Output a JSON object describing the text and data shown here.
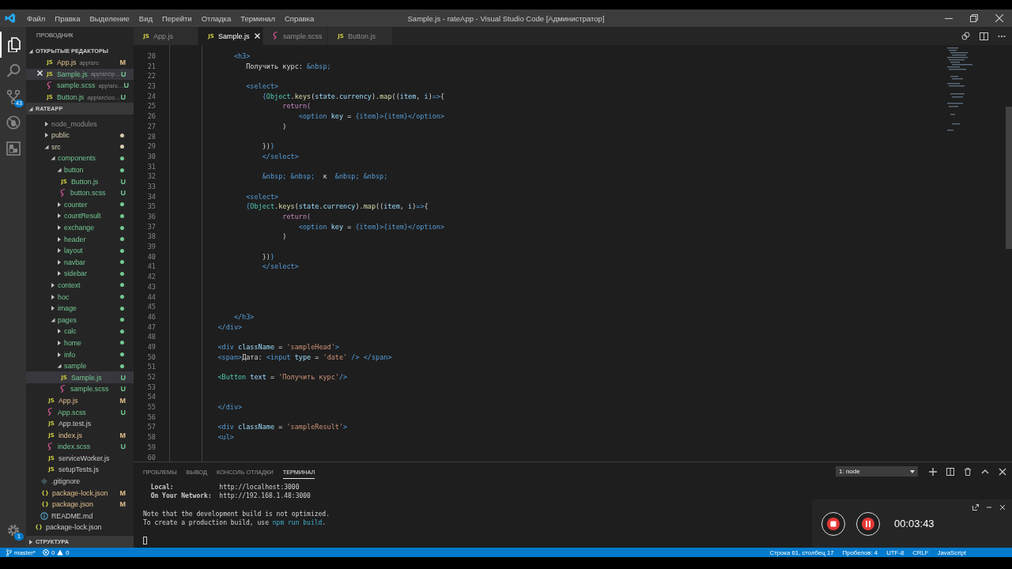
{
  "window": {
    "title": "Sample.js - rateApp - Visual Studio Code [Администратор]"
  },
  "menu": [
    "Файл",
    "Правка",
    "Выделение",
    "Вид",
    "Перейти",
    "Отладка",
    "Терминал",
    "Справка"
  ],
  "activity_bar": [
    {
      "kind": "explorer",
      "selected": true
    },
    {
      "kind": "search",
      "selected": false
    },
    {
      "kind": "source-control",
      "selected": false,
      "badge": "43"
    },
    {
      "kind": "debug",
      "selected": false
    },
    {
      "kind": "extensions",
      "selected": false
    }
  ],
  "manage": {
    "badge": "1"
  },
  "sidebar": {
    "title": "ПРОВОДНИК",
    "open_editors": {
      "title": "ОТКРЫТЫЕ РЕДАКТОРЫ",
      "expanded": true,
      "items": [
        {
          "name": "App.js",
          "path": "app\\src",
          "kind": "js",
          "icon_text": "JS",
          "color": "#e2c08d",
          "badge": "M",
          "selected": false
        },
        {
          "name": "Sample.js",
          "path": "app\\src\\p…",
          "kind": "js",
          "icon_text": "JS",
          "color": "#73c991",
          "badge": "U",
          "selected": true
        },
        {
          "name": "sample.scss",
          "path": "app\\src…",
          "kind": "scss",
          "color": "#73c991",
          "badge": "U",
          "selected": false
        },
        {
          "name": "Button.js",
          "path": "app\\src\\co…",
          "kind": "js",
          "icon_text": "JS",
          "color": "#73c991",
          "badge": "U",
          "selected": false
        }
      ]
    },
    "project": {
      "title": "RATEAPP",
      "expanded": true,
      "items": [
        {
          "name": "node_modules",
          "kind": "folder",
          "expanded": false,
          "ignored": true,
          "selected": false
        },
        {
          "name": "public",
          "kind": "folder",
          "expanded": false,
          "color": "#d9cdb0",
          "selected": false
        },
        {
          "name": "src",
          "kind": "folder",
          "expanded": true,
          "color": "#d9cdb0",
          "selected": false,
          "children": [
            {
              "name": "components",
              "kind": "folder",
              "expanded": true,
              "color": "#73c991",
              "selected": false,
              "children": [
                {
                  "name": "button",
                  "kind": "folder",
                  "expanded": true,
                  "color": "#73c991",
                  "selected": false,
                  "children": [
                    {
                      "name": "Button.js",
                      "kind": "js",
                      "icon_text": "JS",
                      "color": "#73c991",
                      "badge": "U",
                      "selected": false
                    },
                    {
                      "name": "button.scss",
                      "kind": "scss",
                      "color": "#73c991",
                      "badge": "U",
                      "selected": false
                    }
                  ]
                },
                {
                  "name": "counter",
                  "kind": "folder",
                  "expanded": false,
                  "color": "#73c991",
                  "selected": false
                },
                {
                  "name": "countResult",
                  "kind": "folder",
                  "expanded": false,
                  "color": "#73c991",
                  "selected": false
                },
                {
                  "name": "exchange",
                  "kind": "folder",
                  "expanded": false,
                  "color": "#73c991",
                  "selected": false
                },
                {
                  "name": "header",
                  "kind": "folder",
                  "expanded": false,
                  "color": "#73c991",
                  "selected": false
                },
                {
                  "name": "layout",
                  "kind": "folder",
                  "expanded": false,
                  "color": "#73c991",
                  "selected": false
                },
                {
                  "name": "navbar",
                  "kind": "folder",
                  "expanded": false,
                  "color": "#73c991",
                  "selected": false
                },
                {
                  "name": "sidebar",
                  "kind": "folder",
                  "expanded": false,
                  "color": "#73c991",
                  "selected": false
                }
              ]
            },
            {
              "name": "context",
              "kind": "folder",
              "expanded": false,
              "color": "#73c991",
              "selected": false
            },
            {
              "name": "hoc",
              "kind": "folder",
              "expanded": false,
              "color": "#73c991",
              "selected": false
            },
            {
              "name": "image",
              "kind": "folder",
              "expanded": false,
              "color": "#73c991",
              "selected": false
            },
            {
              "name": "pages",
              "kind": "folder",
              "expanded": true,
              "color": "#73c991",
              "selected": false,
              "children": [
                {
                  "name": "calc",
                  "kind": "folder",
                  "expanded": false,
                  "color": "#73c991",
                  "selected": false
                },
                {
                  "name": "home",
                  "kind": "folder",
                  "expanded": false,
                  "color": "#73c991",
                  "selected": false
                },
                {
                  "name": "info",
                  "kind": "folder",
                  "expanded": false,
                  "color": "#73c991",
                  "selected": false
                },
                {
                  "name": "sample",
                  "kind": "folder",
                  "expanded": true,
                  "color": "#73c991",
                  "selected": false,
                  "children": [
                    {
                      "name": "Sample.js",
                      "kind": "js",
                      "icon_text": "JS",
                      "color": "#73c991",
                      "badge": "U",
                      "selected": true
                    },
                    {
                      "name": "sample.scss",
                      "kind": "scss",
                      "color": "#73c991",
                      "badge": "U",
                      "selected": false
                    }
                  ]
                }
              ]
            },
            {
              "name": "App.js",
              "kind": "js",
              "icon_text": "JS",
              "color": "#e2c08d",
              "badge": "M",
              "selected": false
            },
            {
              "name": "App.scss",
              "kind": "scss",
              "color": "#73c991",
              "badge": "U",
              "selected": false
            },
            {
              "name": "App.test.js",
              "kind": "js",
              "icon_text": "JS",
              "selected": false
            },
            {
              "name": "index.js",
              "kind": "js",
              "icon_text": "JS",
              "color": "#e2c08d",
              "badge": "M",
              "selected": false
            },
            {
              "name": "index.scss",
              "kind": "scss",
              "color": "#73c991",
              "badge": "U",
              "selected": false
            },
            {
              "name": "serviceWorker.js",
              "kind": "js",
              "icon_text": "JS",
              "selected": false
            },
            {
              "name": "setupTests.js",
              "kind": "js",
              "icon_text": "JS",
              "selected": false
            }
          ]
        },
        {
          "name": ".gitignore",
          "kind": "gitignore",
          "selected": false
        },
        {
          "name": "package-lock.json",
          "kind": "json",
          "icon_text": "{}",
          "color": "#e2c08d",
          "badge": "M",
          "selected": false
        },
        {
          "name": "package.json",
          "kind": "json",
          "icon_text": "{}",
          "color": "#e2c08d",
          "badge": "M",
          "selected": false
        },
        {
          "name": "README.md",
          "kind": "info",
          "selected": false
        }
      ],
      "root_items": [
        {
          "name": "package-lock.json",
          "kind": "json",
          "icon_text": "{}",
          "selected": false
        }
      ]
    },
    "outline": {
      "title": "СТРУКТУРА",
      "expanded": false
    }
  },
  "tabs": [
    {
      "name": "App.js",
      "kind": "js",
      "icon_text": "JS",
      "selected": false
    },
    {
      "name": "Sample.js",
      "kind": "js",
      "icon_text": "JS",
      "selected": true
    },
    {
      "name": "sample.scss",
      "kind": "scss",
      "selected": false
    },
    {
      "name": "Button.js",
      "kind": "js",
      "icon_text": "JS",
      "selected": false
    }
  ],
  "editor": {
    "lines": [
      {
        "number": "20",
        "tokens": [
          {
            "kind": "tag",
            "text": "                <h3>"
          }
        ]
      },
      {
        "number": "21",
        "tokens": [
          {
            "kind": "txt",
            "text": "                   Получить курс: "
          },
          {
            "kind": "ent",
            "text": "&nbsp;"
          }
        ]
      },
      {
        "number": "22"
      },
      {
        "number": "23",
        "tokens": [
          {
            "kind": "tag",
            "text": "                   <select>"
          }
        ]
      },
      {
        "number": "24",
        "tokens": [
          {
            "kind": "op",
            "text": "                       {"
          },
          {
            "kind": "cls",
            "text": "Object"
          },
          {
            "kind": "txt",
            "text": "."
          },
          {
            "kind": "fn",
            "text": "keys"
          },
          {
            "kind": "txt",
            "text": "("
          },
          {
            "kind": "var",
            "text": "state"
          },
          {
            "kind": "txt",
            "text": "."
          },
          {
            "kind": "var",
            "text": "currency"
          },
          {
            "kind": "txt",
            "text": ")."
          },
          {
            "kind": "fn",
            "text": "map"
          },
          {
            "kind": "txt",
            "text": "(("
          },
          {
            "kind": "var",
            "text": "item"
          },
          {
            "kind": "txt",
            "text": ", "
          },
          {
            "kind": "var",
            "text": "i"
          },
          {
            "kind": "txt",
            "text": ")"
          },
          {
            "kind": "op",
            "text": "=>"
          },
          {
            "kind": "txt",
            "text": "{"
          }
        ]
      },
      {
        "number": "25",
        "tokens": [
          {
            "kind": "kw",
            "text": "                            return("
          }
        ]
      },
      {
        "number": "26",
        "tokens": [
          {
            "kind": "tag",
            "text": "                                <option"
          },
          {
            "kind": "var",
            "text": " key"
          },
          {
            "kind": "txt",
            "text": " = "
          },
          {
            "kind": "op",
            "text": "{item}"
          },
          {
            "kind": "tag",
            "text": ">"
          },
          {
            "kind": "op",
            "text": "{item}"
          },
          {
            "kind": "tag",
            "text": "</option>"
          }
        ]
      },
      {
        "number": "27",
        "tokens": [
          {
            "kind": "txt",
            "text": "                            )"
          }
        ]
      },
      {
        "number": "28"
      },
      {
        "number": "29",
        "tokens": [
          {
            "kind": "txt",
            "text": "                       })"
          },
          {
            "kind": "op",
            "text": "}"
          }
        ]
      },
      {
        "number": "30",
        "tokens": [
          {
            "kind": "tag",
            "text": "                       </select>"
          }
        ]
      },
      {
        "number": "31"
      },
      {
        "number": "32",
        "tokens": [
          {
            "kind": "ent",
            "text": "                       &nbsp; &nbsp;"
          },
          {
            "kind": "txt",
            "text": "  к  "
          },
          {
            "kind": "ent",
            "text": "&nbsp; &nbsp;"
          }
        ]
      },
      {
        "number": "33"
      },
      {
        "number": "34",
        "tokens": [
          {
            "kind": "tag",
            "text": "                   <select>"
          }
        ]
      },
      {
        "number": "35",
        "tokens": [
          {
            "kind": "op",
            "text": "                   {"
          },
          {
            "kind": "cls",
            "text": "Object"
          },
          {
            "kind": "txt",
            "text": "."
          },
          {
            "kind": "fn",
            "text": "keys"
          },
          {
            "kind": "txt",
            "text": "("
          },
          {
            "kind": "var",
            "text": "state"
          },
          {
            "kind": "txt",
            "text": "."
          },
          {
            "kind": "var",
            "text": "currency"
          },
          {
            "kind": "txt",
            "text": ")."
          },
          {
            "kind": "fn",
            "text": "map"
          },
          {
            "kind": "txt",
            "text": "(("
          },
          {
            "kind": "var",
            "text": "item"
          },
          {
            "kind": "txt",
            "text": ", "
          },
          {
            "kind": "var",
            "text": "i"
          },
          {
            "kind": "txt",
            "text": ")"
          },
          {
            "kind": "op",
            "text": "=>"
          },
          {
            "kind": "txt",
            "text": "{"
          }
        ]
      },
      {
        "number": "36",
        "tokens": [
          {
            "kind": "kw",
            "text": "                            return("
          }
        ]
      },
      {
        "number": "37",
        "tokens": [
          {
            "kind": "tag",
            "text": "                                <option"
          },
          {
            "kind": "var",
            "text": " key"
          },
          {
            "kind": "txt",
            "text": " = "
          },
          {
            "kind": "op",
            "text": "{item}"
          },
          {
            "kind": "tag",
            "text": ">"
          },
          {
            "kind": "op",
            "text": "{item}"
          },
          {
            "kind": "tag",
            "text": "</option>"
          }
        ]
      },
      {
        "number": "38",
        "tokens": [
          {
            "kind": "txt",
            "text": "                            )"
          }
        ]
      },
      {
        "number": "39"
      },
      {
        "number": "40",
        "tokens": [
          {
            "kind": "txt",
            "text": "                       })"
          },
          {
            "kind": "op",
            "text": "}"
          }
        ]
      },
      {
        "number": "41",
        "tokens": [
          {
            "kind": "tag",
            "text": "                       </select>"
          }
        ]
      },
      {
        "number": "42"
      },
      {
        "number": "43"
      },
      {
        "number": "44"
      },
      {
        "number": "45"
      },
      {
        "number": "46",
        "tokens": [
          {
            "kind": "tag",
            "text": "                </h3>"
          }
        ]
      },
      {
        "number": "47",
        "tokens": [
          {
            "kind": "tag",
            "text": "            </div>"
          }
        ]
      },
      {
        "number": "48"
      },
      {
        "number": "49",
        "tokens": [
          {
            "kind": "tag",
            "text": "            <div"
          },
          {
            "kind": "var",
            "text": " className"
          },
          {
            "kind": "txt",
            "text": " = "
          },
          {
            "kind": "str",
            "text": "'sampleHead'"
          },
          {
            "kind": "tag",
            "text": ">"
          }
        ]
      },
      {
        "number": "50",
        "tokens": [
          {
            "kind": "tag",
            "text": "            <span>"
          },
          {
            "kind": "txt",
            "text": "Дата: "
          },
          {
            "kind": "tag",
            "text": "<input"
          },
          {
            "kind": "var",
            "text": " type"
          },
          {
            "kind": "txt",
            "text": " = "
          },
          {
            "kind": "str",
            "text": "'date'"
          },
          {
            "kind": "tag",
            "text": " /> </span>"
          }
        ]
      },
      {
        "number": "51"
      },
      {
        "number": "52",
        "tokens": [
          {
            "kind": "cmp",
            "text": "            <Button"
          },
          {
            "kind": "var",
            "text": " text"
          },
          {
            "kind": "txt",
            "text": " = "
          },
          {
            "kind": "str",
            "text": "'Получить курс'"
          },
          {
            "kind": "tag",
            "text": "/>"
          }
        ]
      },
      {
        "number": "53"
      },
      {
        "number": "54"
      },
      {
        "number": "55",
        "tokens": [
          {
            "kind": "tag",
            "text": "            </div>"
          }
        ]
      },
      {
        "number": "56"
      },
      {
        "number": "57",
        "tokens": [
          {
            "kind": "tag",
            "text": "            <div"
          },
          {
            "kind": "var",
            "text": " className"
          },
          {
            "kind": "txt",
            "text": " = "
          },
          {
            "kind": "str",
            "text": "'sampleResult'"
          },
          {
            "kind": "tag",
            "text": ">"
          }
        ]
      },
      {
        "number": "58",
        "tokens": [
          {
            "kind": "tag",
            "text": "            <ul>"
          }
        ]
      },
      {
        "number": "59"
      },
      {
        "number": "60"
      }
    ]
  },
  "panel": {
    "tabs": [
      {
        "label": "ПРОБЛЕМЫ",
        "selected": false
      },
      {
        "label": "ВЫВОД",
        "selected": false
      },
      {
        "label": "КОНСОЛЬ ОТЛАДКИ",
        "selected": false
      },
      {
        "label": "ТЕРМИНАЛ",
        "selected": true
      }
    ],
    "terminal_select": "1: node",
    "terminal_blocks": [
      [
        {
          "tokens": [
            {
              "kind": "bold",
              "text": "  Local:            "
            },
            {
              "kind": "txt",
              "text": "http://localhost:3000"
            }
          ]
        },
        {
          "tokens": [
            {
              "kind": "bold",
              "text": "  On Your Network:  "
            },
            {
              "kind": "txt",
              "text": "http://192.168.1.48:3000"
            }
          ]
        }
      ],
      [
        {
          "tokens": [
            {
              "kind": "txt",
              "text": "Note that the development build is not optimized."
            }
          ]
        },
        {
          "tokens": [
            {
              "kind": "txt",
              "text": "To create a production build, use "
            },
            {
              "kind": "cmd",
              "text": "npm run build"
            },
            {
              "kind": "txt",
              "text": "."
            }
          ]
        }
      ],
      [
        {
          "kind": "cursor"
        }
      ]
    ]
  },
  "recorder": {
    "time": "00:03:43"
  },
  "status_bar": {
    "branch": "master*",
    "errors": "0",
    "warnings": "0",
    "right": [
      "Строка 61, столбец 17",
      "Пробелов: 4",
      "UTF-8",
      "CRLF",
      "JavaScript"
    ]
  }
}
